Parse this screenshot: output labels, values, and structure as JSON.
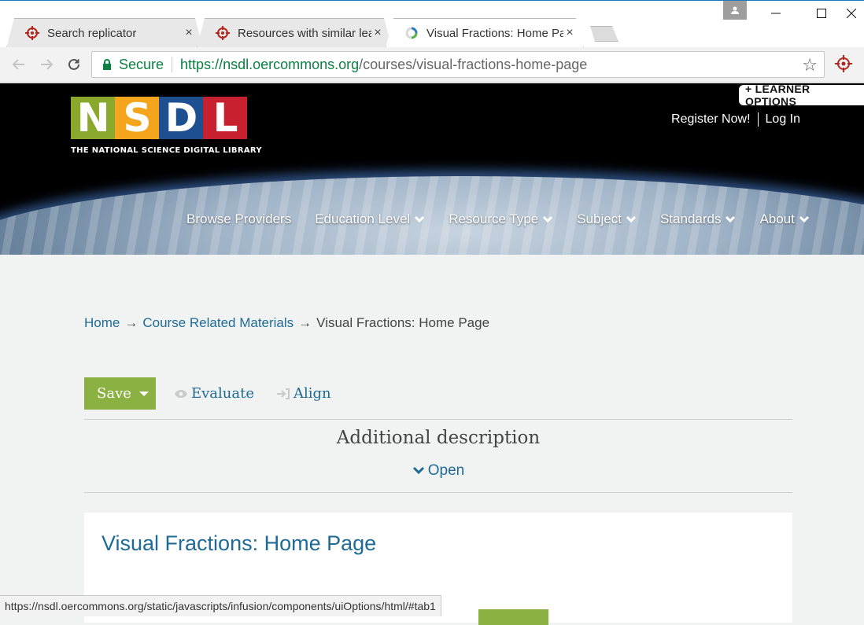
{
  "browser": {
    "tabs": [
      {
        "title": "Search replicator",
        "icon": "crosshair-icon",
        "active": false
      },
      {
        "title": "Resources with similar learning",
        "icon": "crosshair-icon",
        "active": false
      },
      {
        "title": "Visual Fractions: Home Page",
        "icon": "loading-spinner-icon",
        "active": true
      }
    ],
    "tab_close": "×",
    "url": {
      "secure_label": "Secure",
      "host": "https://nsdl.oercommons.org",
      "path": "/courses/visual-fractions-home-page"
    },
    "status_url": "https://nsdl.oercommons.org/static/javascripts/infusion/components/uiOptions/html/#tab1",
    "colors": {
      "secure": "#0b8043",
      "active_tab": "#ffffff"
    }
  },
  "header": {
    "logo_letters": [
      "N",
      "S",
      "D",
      "L"
    ],
    "logo_colors": [
      "#8aa82c",
      "#f4a51c",
      "#1d4f91",
      "#c7202f"
    ],
    "tagline": "THE NATIONAL SCIENCE DIGITAL LIBRARY",
    "learner_options": "+ LEARNER OPTIONS",
    "register": "Register Now!",
    "login": "Log In",
    "nav": [
      {
        "label": "Browse Providers",
        "dropdown": false
      },
      {
        "label": "Education Level",
        "dropdown": true
      },
      {
        "label": "Resource Type",
        "dropdown": true
      },
      {
        "label": "Subject",
        "dropdown": true
      },
      {
        "label": "Standards",
        "dropdown": true
      },
      {
        "label": "About",
        "dropdown": true
      }
    ]
  },
  "breadcrumb": {
    "home": "Home",
    "section": "Course Related Materials",
    "current": "Visual Fractions: Home Page",
    "arrow": "→"
  },
  "actions": {
    "save": "Save",
    "evaluate": "Evaluate",
    "align": "Align"
  },
  "description": {
    "heading": "Additional description",
    "toggle": "Open"
  },
  "resource": {
    "title": "Visual Fractions: Home Page"
  }
}
